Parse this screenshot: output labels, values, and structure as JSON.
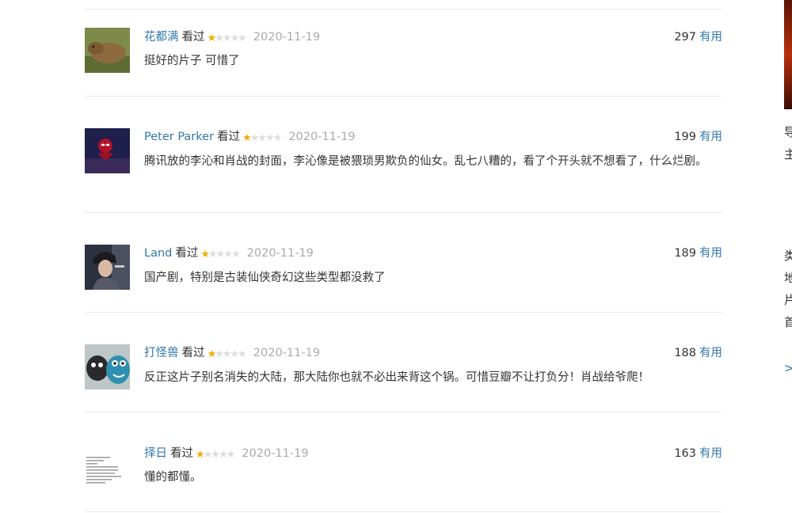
{
  "comments": [
    {
      "user": "花都满",
      "status": "看过",
      "rating": 1,
      "date": "2020-11-19",
      "votes": "297",
      "useful": "有用",
      "text": "挺好的片子 可惜了",
      "avatar": "capybara"
    },
    {
      "user": "Peter Parker",
      "status": "看过",
      "rating": 1,
      "date": "2020-11-19",
      "votes": "199",
      "useful": "有用",
      "text": "腾讯放的李沁和肖战的封面，李沁像是被猥琐男欺负的仙女。乱七八糟的，看了个开头就不想看了，什么烂剧。",
      "avatar": "spiderman"
    },
    {
      "user": "Land",
      "status": "看过",
      "rating": 1,
      "date": "2020-11-19",
      "votes": "189",
      "useful": "有用",
      "text": "国产剧，特别是古装仙侠奇幻这些类型都没救了",
      "avatar": "woman-photo"
    },
    {
      "user": "打怪兽",
      "status": "看过",
      "rating": 1,
      "date": "2020-11-19",
      "votes": "188",
      "useful": "有用",
      "text": "反正这片子别名消失的大陆，那大陆你也就不必出来背这个锅。可惜豆瓣不让打负分！肖战给爷爬！",
      "avatar": "plush-toys"
    },
    {
      "user": "择日",
      "status": "看过",
      "rating": 1,
      "date": "2020-11-19",
      "votes": "163",
      "useful": "有用",
      "text": "懂的都懂。",
      "avatar": "terminal-text"
    }
  ],
  "right_column": {
    "lines": [
      "导",
      "主",
      "类",
      "地",
      "片",
      "首",
      ">"
    ]
  },
  "colors": {
    "link": "#3377aa",
    "star": "#f6ab00",
    "star_off": "#dddddd",
    "date": "#aaaaaa",
    "divider": "#eaeaea"
  }
}
